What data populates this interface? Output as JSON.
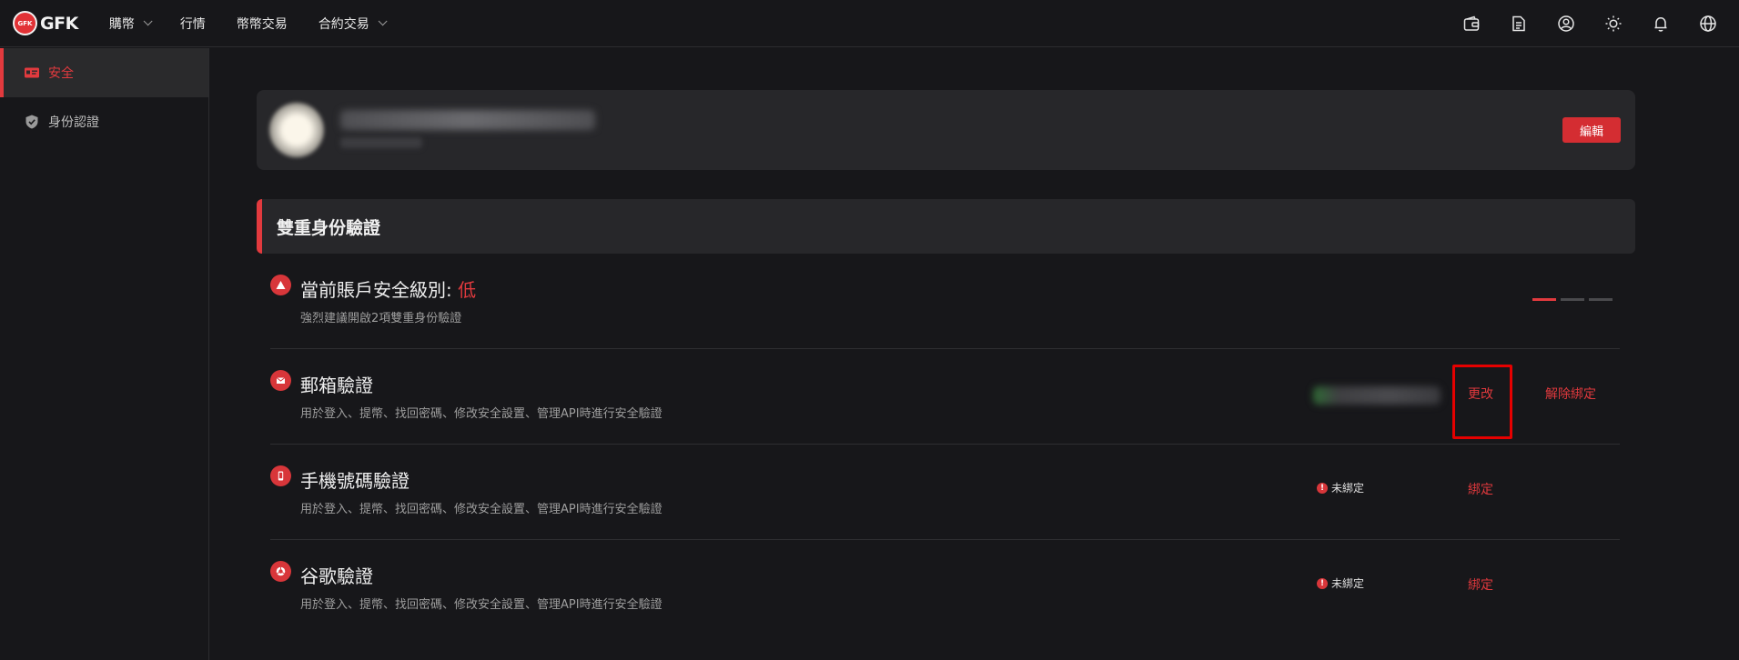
{
  "brand": {
    "logo_badge": "GFK",
    "name": "GFK",
    "accent": "#e23a3e"
  },
  "nav": [
    {
      "label": "購幣",
      "caret": true
    },
    {
      "label": "行情",
      "caret": false
    },
    {
      "label": "幣幣交易",
      "caret": false
    },
    {
      "label": "合約交易",
      "caret": true
    }
  ],
  "top_icons": [
    "wallet-icon",
    "orders-icon",
    "account-icon",
    "theme-sun-icon",
    "bell-icon",
    "globe-icon"
  ],
  "sidebar": {
    "items": [
      {
        "label": "安全",
        "icon": "id-card-icon",
        "active": true
      },
      {
        "label": "身份認證",
        "icon": "shield-check-icon",
        "active": false
      }
    ]
  },
  "profile": {
    "edit_label": "編輯"
  },
  "section": {
    "title": "雙重身份驗證"
  },
  "security_level": {
    "title": "當前賬戶安全級別: ",
    "level": "低",
    "desc": "強烈建議開啟2項雙重身份驗證",
    "bars_on": 1,
    "bars_total": 3
  },
  "verifications": {
    "email": {
      "title": "郵箱驗證",
      "desc": "用於登入、提幣、找回密碼、修改安全設置、管理API時進行安全驗證",
      "change_label": "更改",
      "unbind_label": "解除綁定"
    },
    "phone": {
      "title": "手機號碼驗證",
      "desc": "用於登入、提幣、找回密碼、修改安全設置、管理API時進行安全驗證",
      "status": "未綁定",
      "bind_label": "綁定"
    },
    "google": {
      "title": "谷歌驗證",
      "desc": "用於登入、提幣、找回密碼、修改安全設置、管理API時進行安全驗證",
      "status": "未綁定",
      "bind_label": "綁定"
    }
  }
}
